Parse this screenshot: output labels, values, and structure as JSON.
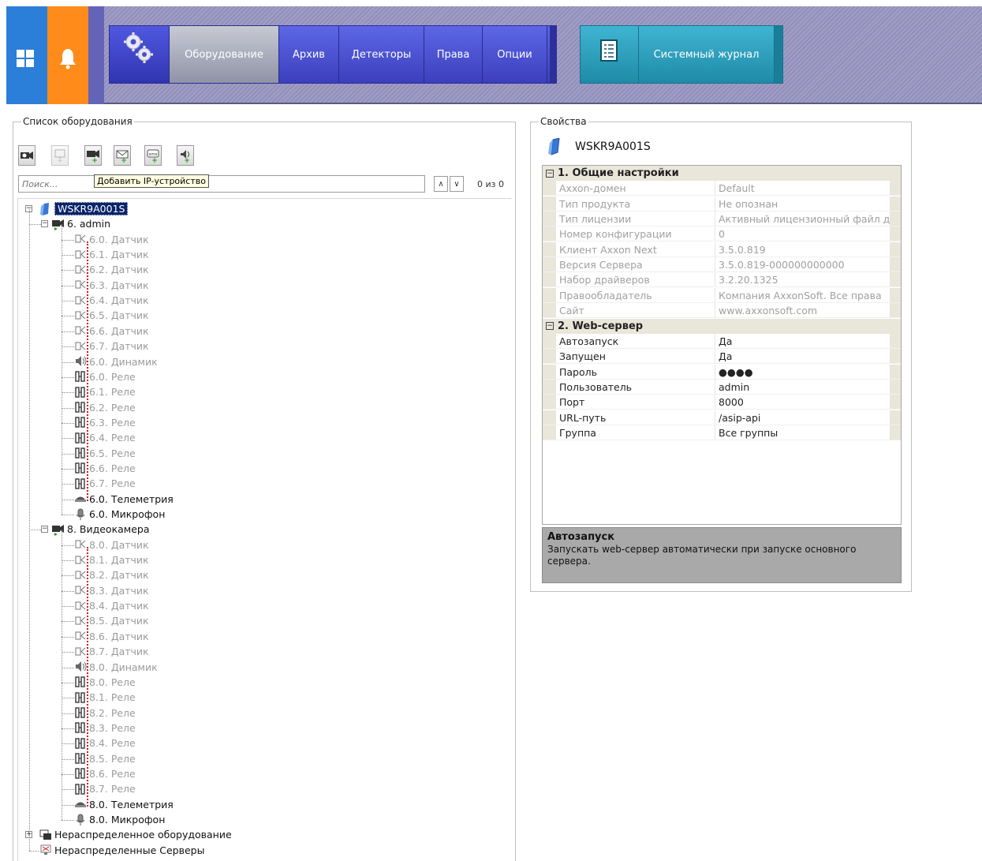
{
  "header": {
    "nav_tabs": [
      "Оборудование",
      "Архив",
      "Детекторы",
      "Права",
      "Опции"
    ],
    "active_tab": "Оборудование",
    "system_log": "Системный журнал",
    "colors": {
      "windows_tile": "#2b7fd8",
      "bell_tile": "#ff8c1a",
      "nav_blue": "#4a4fd0",
      "log_teal": "#2a9fbf"
    }
  },
  "equipment": {
    "legend": "Список оборудования",
    "toolbar_icons": [
      "camera-search-icon",
      "add-monitor-icon",
      "add-camera-icon",
      "add-email-icon",
      "add-sms-icon",
      "add-speaker-icon"
    ],
    "tooltip": "Добавить IP-устройство",
    "search_placeholder": "Поиск...",
    "counter": "0 из 0",
    "tree": {
      "server": "WSKR9A001S",
      "devices": [
        {
          "label": "6. admin",
          "children": [
            {
              "label": "6.0. Датчик",
              "type": "sensor"
            },
            {
              "label": "6.1. Датчик",
              "type": "sensor"
            },
            {
              "label": "6.2. Датчик",
              "type": "sensor"
            },
            {
              "label": "6.3. Датчик",
              "type": "sensor"
            },
            {
              "label": "6.4. Датчик",
              "type": "sensor"
            },
            {
              "label": "6.5. Датчик",
              "type": "sensor"
            },
            {
              "label": "6.6. Датчик",
              "type": "sensor"
            },
            {
              "label": "6.7. Датчик",
              "type": "sensor"
            },
            {
              "label": "6.0. Динамик",
              "type": "speaker"
            },
            {
              "label": "6.0. Реле",
              "type": "relay"
            },
            {
              "label": "6.1. Реле",
              "type": "relay"
            },
            {
              "label": "6.2. Реле",
              "type": "relay"
            },
            {
              "label": "6.3. Реле",
              "type": "relay"
            },
            {
              "label": "6.4. Реле",
              "type": "relay"
            },
            {
              "label": "6.5. Реле",
              "type": "relay"
            },
            {
              "label": "6.6. Реле",
              "type": "relay"
            },
            {
              "label": "6.7. Реле",
              "type": "relay"
            },
            {
              "label": "6.0. Телеметрия",
              "type": "telemetry"
            },
            {
              "label": "6.0. Микрофон",
              "type": "microphone"
            }
          ]
        },
        {
          "label": "8. Видеокамера",
          "children": [
            {
              "label": "8.0. Датчик",
              "type": "sensor"
            },
            {
              "label": "8.1. Датчик",
              "type": "sensor"
            },
            {
              "label": "8.2. Датчик",
              "type": "sensor"
            },
            {
              "label": "8.3. Датчик",
              "type": "sensor"
            },
            {
              "label": "8.4. Датчик",
              "type": "sensor"
            },
            {
              "label": "8.5. Датчик",
              "type": "sensor"
            },
            {
              "label": "8.6. Датчик",
              "type": "sensor"
            },
            {
              "label": "8.7. Датчик",
              "type": "sensor"
            },
            {
              "label": "8.0. Динамик",
              "type": "speaker"
            },
            {
              "label": "8.0. Реле",
              "type": "relay"
            },
            {
              "label": "8.1. Реле",
              "type": "relay"
            },
            {
              "label": "8.2. Реле",
              "type": "relay"
            },
            {
              "label": "8.3. Реле",
              "type": "relay"
            },
            {
              "label": "8.4. Реле",
              "type": "relay"
            },
            {
              "label": "8.5. Реле",
              "type": "relay"
            },
            {
              "label": "8.6. Реле",
              "type": "relay"
            },
            {
              "label": "8.7. Реле",
              "type": "relay"
            },
            {
              "label": "8.0. Телеметрия",
              "type": "telemetry"
            },
            {
              "label": "8.0. Микрофон",
              "type": "microphone"
            }
          ]
        }
      ],
      "unassigned_equipment": "Нераспределенное оборудование",
      "unassigned_servers": "Нераспределенные Серверы"
    }
  },
  "properties": {
    "legend": "Свойства",
    "title": "WSKR9A001S",
    "sections": [
      {
        "title": "1. Общие настройки",
        "readonly": true,
        "rows": [
          {
            "key": "Axxon-домен",
            "value": "Default"
          },
          {
            "key": "Тип продукта",
            "value": "Не опознан"
          },
          {
            "key": "Тип лицензии",
            "value": "Активный лицензионный файл д"
          },
          {
            "key": "Номер конфигурации",
            "value": "0"
          },
          {
            "key": "Клиент Axxon Next",
            "value": "3.5.0.819"
          },
          {
            "key": "Версия Сервера",
            "value": "3.5.0.819-000000000000"
          },
          {
            "key": "Набор драйверов",
            "value": "3.2.20.1325"
          },
          {
            "key": "Правообладатель",
            "value": "Компания AxxonSoft. Все права"
          },
          {
            "key": "Сайт",
            "value": "www.axxonsoft.com"
          }
        ]
      },
      {
        "title": "2. Web-сервер",
        "readonly": false,
        "rows": [
          {
            "key": "Автозапуск",
            "value": "Да"
          },
          {
            "key": "Запущен",
            "value": "Да"
          },
          {
            "key": "Пароль",
            "value": "●●●●"
          },
          {
            "key": "Пользователь",
            "value": "admin"
          },
          {
            "key": "Порт",
            "value": "8000"
          },
          {
            "key": "URL-путь",
            "value": "/asip-api"
          },
          {
            "key": "Группа",
            "value": "Все группы"
          }
        ]
      }
    ],
    "description": {
      "title": "Автозапуск",
      "text": "Запускать web-сервер автоматически при запуске основного сервера."
    }
  }
}
